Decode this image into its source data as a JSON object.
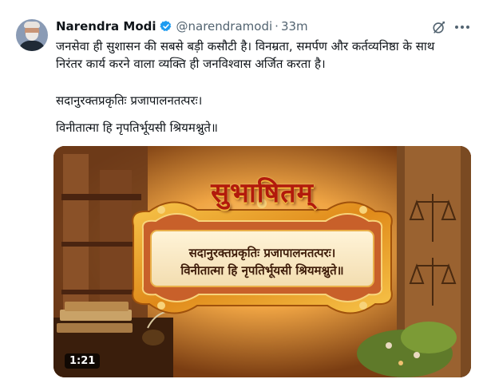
{
  "post": {
    "author_name": "Narendra Modi",
    "handle": "@narendramodi",
    "separator": "·",
    "time": "33m",
    "lines": [
      "जनसेवा ही सुशासन की सबसे बड़ी कसौटी है। विनम्रता, समर्पण और कर्तव्यनिष्ठा के साथ",
      "निरंतर कार्य करने वाला व्यक्ति ही जनविश्वास अर्जित करता है।",
      "सदानुरक्तप्रकृतिः प्रजापालनतत्परः।",
      "विनीतात्मा हि नृपतिर्भूयसी श्रियमश्नुते॥"
    ]
  },
  "media": {
    "headline": "सुभाषितम्",
    "verse_line1": "सदानुरक्तप्रकृतिः प्रजापालनतत्परः।",
    "verse_line2": "विनीतात्मा हि नृपतिर्भूयसी श्रियमश्नुते॥",
    "duration": "1:21"
  },
  "icons": {
    "verified": "verified-badge-icon",
    "grok": "grok-icon",
    "more": "more-options-icon"
  },
  "colors": {
    "verified_blue": "#1d9bf0",
    "text_primary": "#0f1419",
    "text_secondary": "#536471",
    "headline_red": "#b21a0c"
  }
}
